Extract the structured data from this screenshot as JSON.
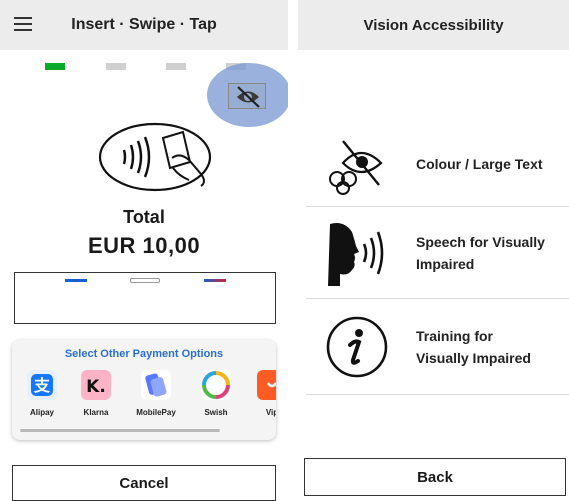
{
  "payment": {
    "title": "Insert · Swipe · Tap",
    "menu_icon": "hamburger-menu-icon",
    "progress": {
      "active_step": 1,
      "steps": 4,
      "active_color": "#0aa82a"
    },
    "accessibility_icon": "eye-slash-icon",
    "reader_icon": "contactless-card-icon",
    "total_label": "Total",
    "total_amount": "EUR 10,00",
    "other_options": {
      "title": "Select Other Payment Options",
      "items": [
        {
          "label": "Alipay",
          "icon": "alipay-icon",
          "color": "#1677ff"
        },
        {
          "label": "Klarna",
          "icon": "klarna-icon",
          "color": "#ffb3c7"
        },
        {
          "label": "MobilePay",
          "icon": "mobilepay-icon",
          "color": "#5a78ff"
        },
        {
          "label": "Swish",
          "icon": "swish-icon",
          "color": "#52b848"
        },
        {
          "label": "Vip",
          "icon": "vipps-icon",
          "color": "#ff5b24"
        }
      ]
    },
    "cancel_label": "Cancel"
  },
  "accessibility": {
    "title": "Vision Accessibility",
    "items": [
      {
        "label_line1": "Colour / Large Text",
        "label_line2": "",
        "icon": "colour-blind-eye-icon"
      },
      {
        "label_line1": "Speech for Visually",
        "label_line2": "Impaired",
        "icon": "speaking-head-icon"
      },
      {
        "label_line1": "Training for",
        "label_line2": "Visually Impaired",
        "icon": "information-icon"
      }
    ],
    "back_label": "Back"
  }
}
